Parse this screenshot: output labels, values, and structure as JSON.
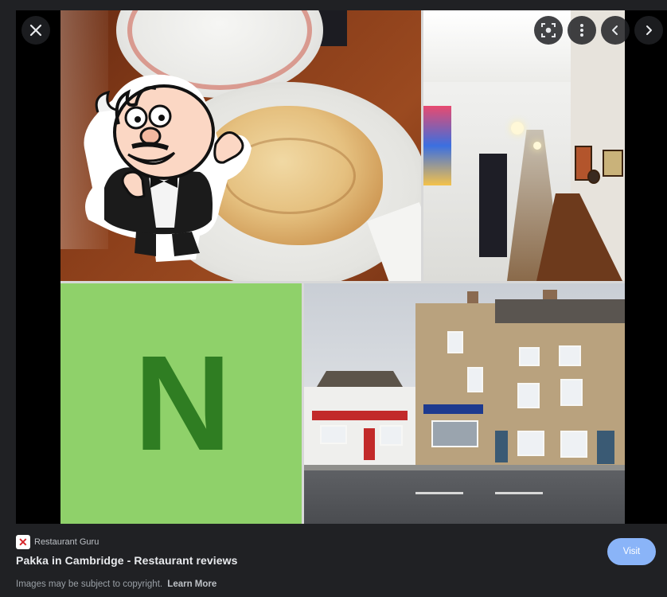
{
  "controls": {
    "close_icon": "close-icon",
    "lens_icon": "lens-search-icon",
    "more_icon": "more-vert-icon",
    "prev_icon": "chevron-left-icon",
    "next_icon": "chevron-right-icon"
  },
  "image": {
    "logo_letter": "N",
    "tile_colors": {
      "logo_bg": "#8fd16a",
      "logo_letter": "#2f7d22"
    }
  },
  "info": {
    "source_favicon_glyph": "✕",
    "source_name": "Restaurant Guru",
    "page_title": "Pakka in Cambridge - Restaurant reviews",
    "copyright_text": "Images may be subject to copyright.",
    "learn_more_label": "Learn More",
    "visit_label": "Visit"
  },
  "colors": {
    "background": "#202124",
    "accent": "#8ab4f8",
    "text_primary": "#e8eaed",
    "text_secondary": "#9aa0a6"
  }
}
